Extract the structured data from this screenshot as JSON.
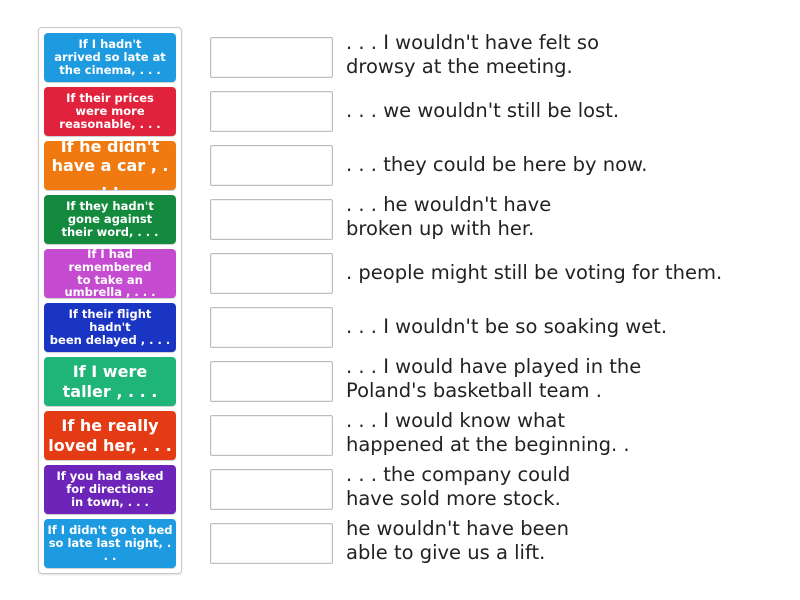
{
  "activity": {
    "type": "match-up",
    "tiles": [
      {
        "text": "If I hadn't\narrived so late at\nthe cinema, . . .",
        "color": "#1e9be0",
        "size": "small"
      },
      {
        "text": "If their prices\nwere more\nreasonable, . . .",
        "color": "#e0223c",
        "size": "small"
      },
      {
        "text": "If he didn't\nhave a car , . . .",
        "color": "#f07a10",
        "size": "large"
      },
      {
        "text": "If they hadn't\ngone against\ntheir word, . . .",
        "color": "#138a3e",
        "size": "small"
      },
      {
        "text": "If I had remembered\nto take an\numbrella , . . .",
        "color": "#c54bd0",
        "size": "small"
      },
      {
        "text": "If their flight hadn't\nbeen delayed , . . .",
        "color": "#1a35c4",
        "size": "small"
      },
      {
        "text": "If I were\ntaller , . . .",
        "color": "#1fb478",
        "size": "large"
      },
      {
        "text": "If he really\nloved her, . . .",
        "color": "#e53b14",
        "size": "large"
      },
      {
        "text": "If you had asked\nfor directions\nin town, . . .",
        "color": "#6c25b8",
        "size": "small"
      },
      {
        "text": "If I didn't go to bed\nso late last night, . . .",
        "color": "#1e9be0",
        "size": "small"
      }
    ],
    "answers": [
      {
        "text": ". . . I wouldn't have felt so\ndrowsy at the meeting."
      },
      {
        "text": ". . . we wouldn't still be lost."
      },
      {
        "text": ". . . they could be here by now."
      },
      {
        "text": ". . . he wouldn't have\nbroken up with her."
      },
      {
        "text": ". people might still be voting for them."
      },
      {
        "text": ". . . I wouldn't be so soaking wet."
      },
      {
        "text": ". . . I would have played in the\nPoland's basketball team ."
      },
      {
        "text": ". . . I would know what\nhappened at the beginning. ."
      },
      {
        "text": ". . . the company could\nhave sold more stock."
      },
      {
        "text": "he wouldn't have been\nable to give us a lift."
      }
    ]
  }
}
